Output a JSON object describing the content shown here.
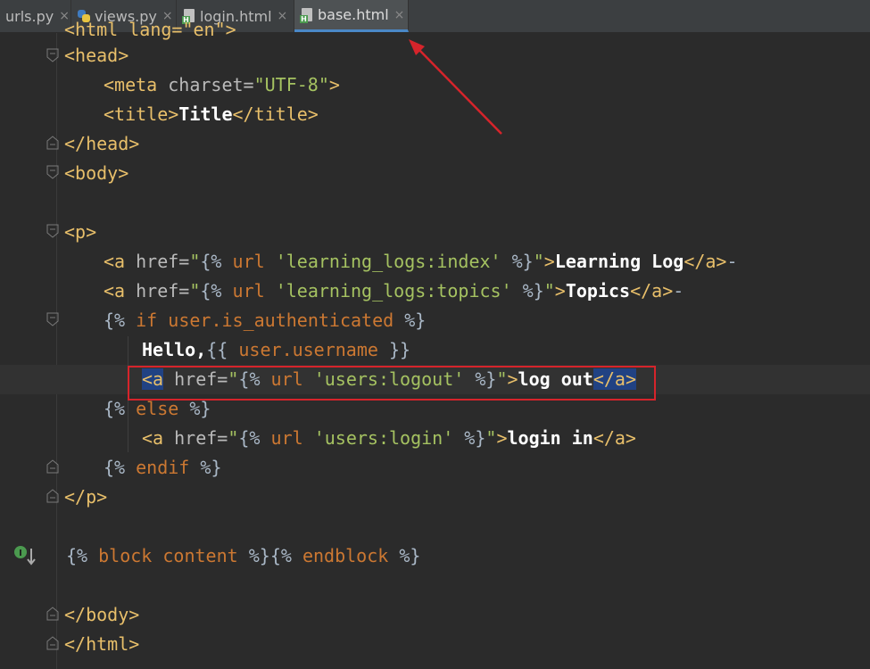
{
  "tabs": [
    {
      "label": "urls.py",
      "icon": "python-file-icon",
      "active": false
    },
    {
      "label": "views.py",
      "icon": "python-file-icon",
      "active": false
    },
    {
      "label": "login.html",
      "icon": "html-file-icon",
      "active": false
    },
    {
      "label": "base.html",
      "icon": "html-file-icon",
      "active": true
    }
  ],
  "close_glyph": "×",
  "code": {
    "l1": "<html lang=\"en\">",
    "head_open": "<head>",
    "meta_open": "<meta ",
    "meta_attr": "charset=",
    "meta_val": "\"UTF-8\"",
    "meta_close": ">",
    "title_open": "<title>",
    "title_text": "Title",
    "title_close": "</title>",
    "head_close": "</head>",
    "body_open": "<body>",
    "p_open": "<p>",
    "a_open": "<a ",
    "href": "href=",
    "q": "\"",
    "tpl_open": "{%",
    "tpl_close": "%}",
    "url_kw": "url",
    "link1_name": "'learning_logs:index'",
    "link1_text": "Learning Log",
    "a_close": "</a>",
    "dash": "-",
    "link2_name": "'learning_logs:topics'",
    "link2_text": "Topics",
    "if_line_kw": "if",
    "if_line_var": "user",
    "if_line_attr": ".is_authenticated",
    "hello_text": "Hello,",
    "var_open": "{{",
    "var_user": "user",
    "var_attr": ".username",
    "var_close": "}}",
    "logout_name": "'users:logout'",
    "logout_text": "log out",
    "else_kw": "else",
    "login_name": "'users:login'",
    "login_text": "login in",
    "endif_kw": "endif",
    "p_close": "</p>",
    "block_kw": "block content",
    "endblock_kw": "endblock",
    "body_close": "</body>",
    "html_close": "</html>"
  },
  "colors": {
    "background": "#2b2b2b",
    "tag": "#e8bf6a",
    "string": "#a5c261",
    "template_keyword": "#cc7832",
    "selection": "#214283",
    "annotation_red": "#d6242b"
  }
}
